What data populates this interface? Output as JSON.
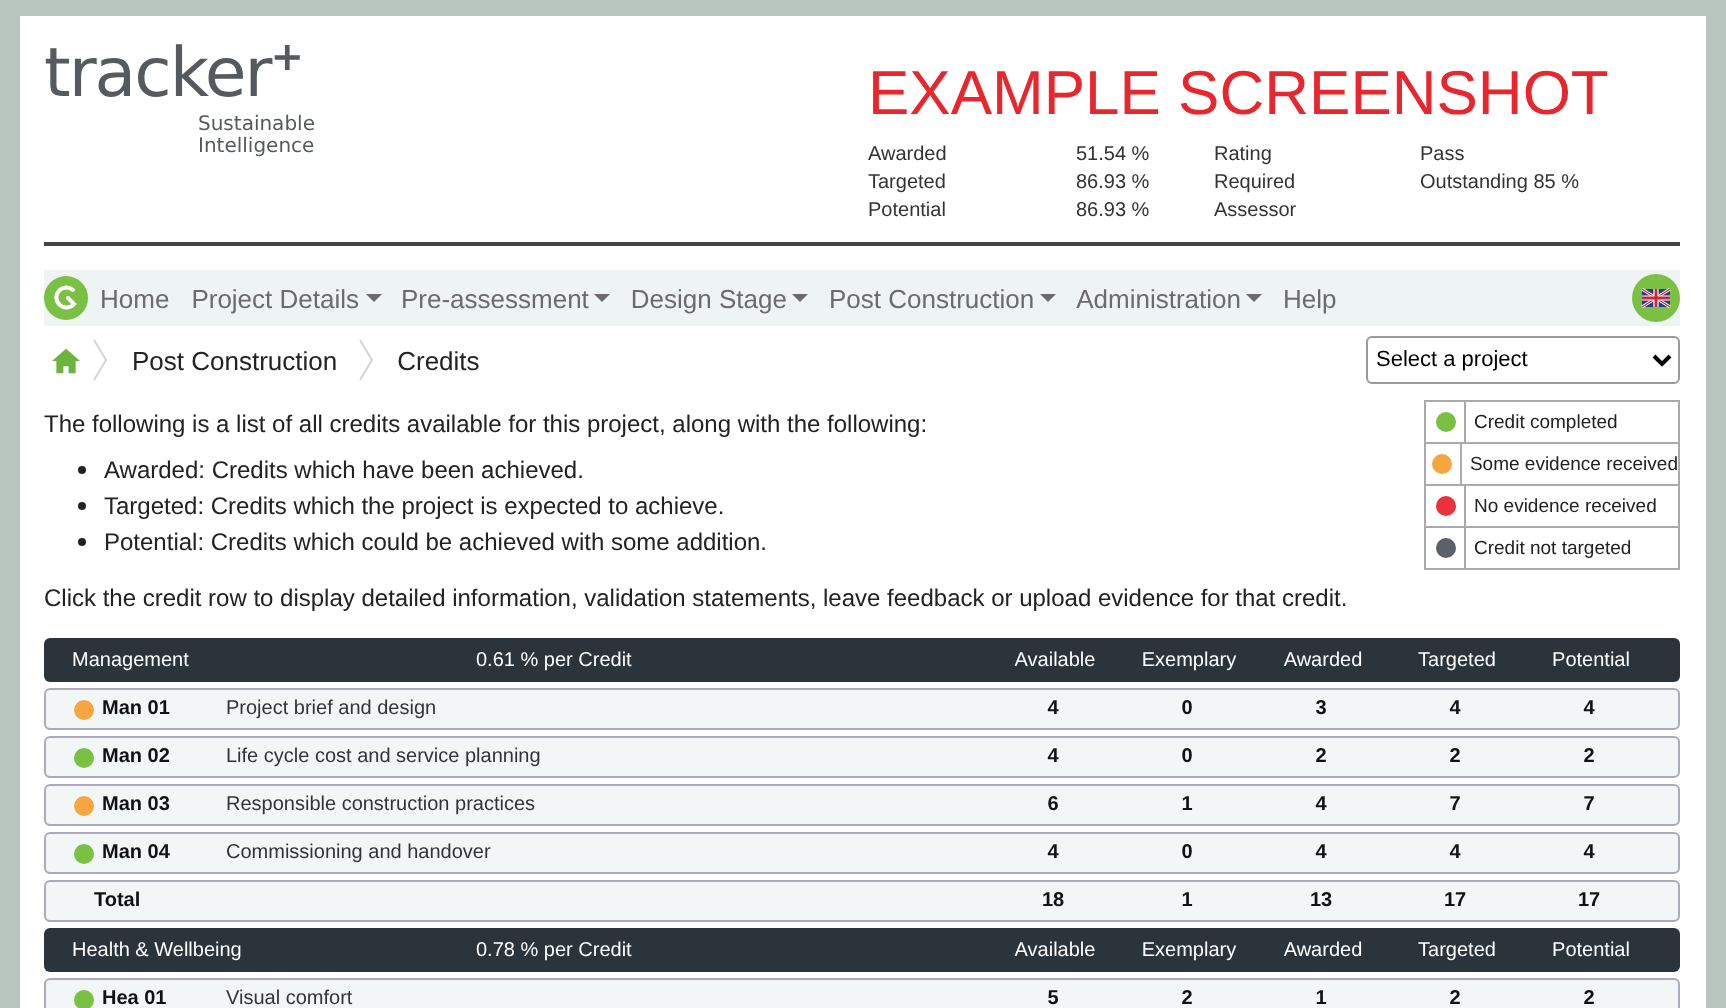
{
  "logo": {
    "wordmark": "tracker",
    "mark": "+",
    "tagline": [
      "Sustainable",
      "Intelligence"
    ]
  },
  "banner": "EXAMPLE SCREENSHOT",
  "summary": [
    {
      "label": "Awarded",
      "value": "51.54 %",
      "label_2": "Rating",
      "value_2": "Pass"
    },
    {
      "label": "Targeted",
      "value": "86.93 %",
      "label_2": "Required",
      "value_2": "Outstanding 85 %"
    },
    {
      "label": "Potential",
      "value": "86.93 %",
      "label_2": "Assessor"
    }
  ],
  "nav": {
    "items": [
      {
        "label": "Home",
        "dropdown": false
      },
      {
        "label": "Project Details",
        "dropdown": true
      },
      {
        "label": "Pre-assessment",
        "dropdown": true
      },
      {
        "label": "Design Stage",
        "dropdown": true
      },
      {
        "label": "Post Construction",
        "dropdown": true
      },
      {
        "label": "Administration",
        "dropdown": true
      },
      {
        "label": "Help",
        "dropdown": false
      }
    ]
  },
  "breadcrumb": [
    "Post Construction",
    "Credits"
  ],
  "project_select": {
    "value": "Select a project"
  },
  "intro": "The following is a list of all credits available for this project, along with the following:",
  "bullets": [
    "Awarded: Credits which have been achieved.",
    "Targeted: Credits which the project is expected to achieve.",
    "Potential: Credits which could be achieved with some addition."
  ],
  "instruction": "Click the credit row to display detailed information, validation statements, leave feedback or upload evidence for that credit.",
  "legend": [
    {
      "label": "Credit completed",
      "color": "#7ac143"
    },
    {
      "label": "Some evidence received",
      "color": "#f7a541"
    },
    {
      "label": "No evidence received",
      "color": "#e8323c"
    },
    {
      "label": "Credit not targeted",
      "color": "#5a6168"
    }
  ],
  "sections": [
    {
      "name": "Management",
      "rate": "0.61 % per Credit",
      "columns": [
        "Available",
        "Exemplary",
        "Awarded",
        "Targeted",
        "Potential"
      ],
      "rows": [
        {
          "code": "Man 01",
          "title": "Project brief and design",
          "color": "#f7a541",
          "values": [
            "4",
            "0",
            "3",
            "4",
            "4"
          ]
        },
        {
          "code": "Man 02",
          "title": "Life cycle cost and service planning",
          "color": "#7ac143",
          "values": [
            "4",
            "0",
            "2",
            "2",
            "2"
          ]
        },
        {
          "code": "Man 03",
          "title": "Responsible construction practices",
          "color": "#f7a541",
          "values": [
            "6",
            "1",
            "4",
            "7",
            "7"
          ]
        },
        {
          "code": "Man 04",
          "title": "Commissioning and handover",
          "color": "#7ac143",
          "values": [
            "4",
            "0",
            "4",
            "4",
            "4"
          ]
        }
      ],
      "total": {
        "label": "Total",
        "values": [
          "18",
          "1",
          "13",
          "17",
          "17"
        ]
      }
    },
    {
      "name": "Health & Wellbeing",
      "rate": "0.78 % per Credit",
      "columns": [
        "Available",
        "Exemplary",
        "Awarded",
        "Targeted",
        "Potential"
      ],
      "rows": [
        {
          "code": "Hea 01",
          "title": "Visual comfort",
          "color": "#7ac143",
          "values": [
            "5",
            "2",
            "1",
            "2",
            "2"
          ]
        }
      ]
    }
  ]
}
